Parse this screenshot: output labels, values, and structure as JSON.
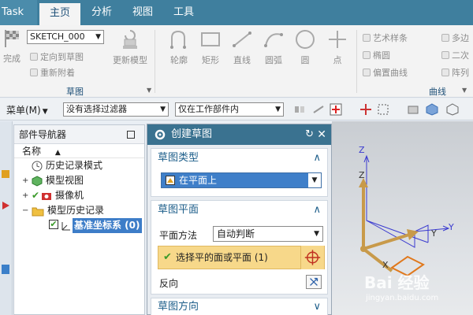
{
  "menubar": {
    "app_tab": "Task",
    "tabs": [
      {
        "label": "主页",
        "active": true
      },
      {
        "label": "分析",
        "active": false
      },
      {
        "label": "视图",
        "active": false
      },
      {
        "label": "工具",
        "active": false
      }
    ]
  },
  "ribbon": {
    "finish_label": "完成",
    "sketch_name": "SKETCH_000",
    "orient_label": "定向到草图",
    "reattach_label": "重新附着",
    "update_model_label": "更新模型",
    "curve_tools": [
      {
        "label": "轮廓",
        "icon": "profile-icon"
      },
      {
        "label": "矩形",
        "icon": "rectangle-icon"
      },
      {
        "label": "直线",
        "icon": "line-icon"
      },
      {
        "label": "圆弧",
        "icon": "arc-icon"
      },
      {
        "label": "圆",
        "icon": "circle-icon"
      },
      {
        "label": "点",
        "icon": "point-icon"
      }
    ],
    "curve_small": [
      {
        "label": "艺术样条",
        "icon": "spline-icon"
      },
      {
        "label": "椭圆",
        "icon": "ellipse-icon"
      },
      {
        "label": "偏置曲线",
        "icon": "offset-curve-icon"
      },
      {
        "label": "多边",
        "icon": "polygon-icon"
      },
      {
        "label": "二次",
        "icon": "conic-icon"
      },
      {
        "label": "阵列",
        "icon": "pattern-icon"
      }
    ],
    "group_sketch": "草图",
    "group_curve": "曲线"
  },
  "toolbar": {
    "menu_label": "菜单(M)",
    "filter_value": "没有选择过滤器",
    "scope_value": "仅在工作部件内"
  },
  "navigator": {
    "title": "部件导航器",
    "column_name": "名称",
    "items": [
      {
        "label": "历史记录模式",
        "icon": "clock-icon"
      },
      {
        "label": "模型视图",
        "icon": "model-view-icon"
      },
      {
        "label": "摄像机",
        "icon": "camera-icon"
      },
      {
        "label": "模型历史记录",
        "icon": "folder-icon"
      },
      {
        "label": "基准坐标系 (0)",
        "icon": "datum-csys-icon"
      }
    ]
  },
  "dialog": {
    "title": "创建草图",
    "sketch_type": {
      "heading": "草图类型",
      "value": "在平面上"
    },
    "sketch_plane": {
      "heading": "草图平面",
      "method_label": "平面方法",
      "method_value": "自动判断",
      "pick_label": "选择平的面或平面 (1)",
      "reverse_label": "反向"
    },
    "sketch_orientation": {
      "heading": "草图方向"
    }
  },
  "viewport": {
    "axis_labels": [
      "Z",
      "Z",
      "Y",
      "Y",
      "X"
    ],
    "watermark": "Bai 经验",
    "watermark_url": "jingyan.baidu.com"
  },
  "colors": {
    "accent": "#3a7290",
    "selection": "#3d7dc8",
    "highlight": "#f7d88a",
    "axis": "#3a3ad0",
    "frame": "#c89a4a",
    "plane": "#e0781c"
  }
}
